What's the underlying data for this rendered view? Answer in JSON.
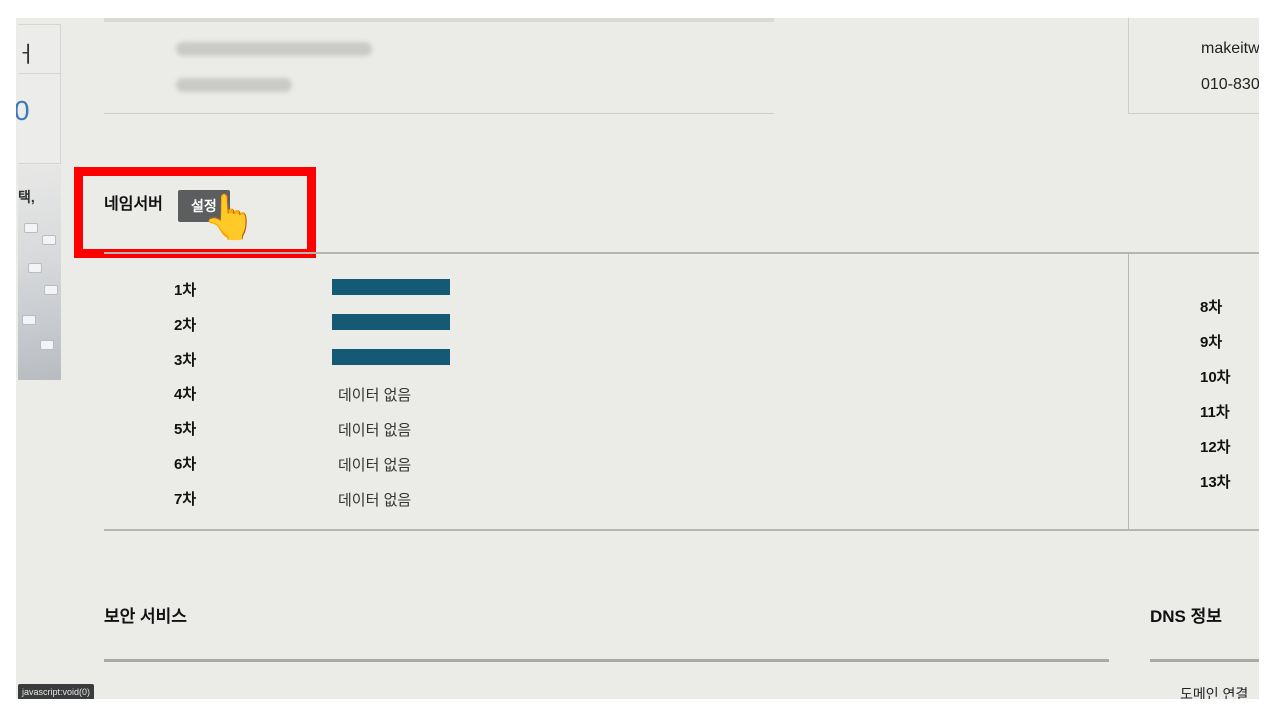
{
  "left_panel": {
    "card_char_top": "ㅓ",
    "card_char_bottom": "0",
    "banner_text": "택,"
  },
  "contact": {
    "right_email": "makeitw",
    "right_phone": "010-830"
  },
  "nameserver": {
    "title": "네임서버",
    "settings_button": "설정",
    "rows": [
      {
        "label": "1차",
        "value": ""
      },
      {
        "label": "2차",
        "value": ""
      },
      {
        "label": "3차",
        "value": ""
      },
      {
        "label": "4차",
        "value": "데이터 없음"
      },
      {
        "label": "5차",
        "value": "데이터 없음"
      },
      {
        "label": "6차",
        "value": "데이터 없음"
      },
      {
        "label": "7차",
        "value": "데이터 없음"
      }
    ],
    "right_labels": [
      "8차",
      "9차",
      "10차",
      "11차",
      "12차",
      "13차"
    ]
  },
  "security": {
    "title": "보안 서비스"
  },
  "dns": {
    "title": "DNS 정보",
    "domain_link": "도메인 연결"
  },
  "status_bar": {
    "link_preview": "javascript:void(0)"
  },
  "colors": {
    "highlight": "#ff0000",
    "button_bg": "#5b5d5f",
    "redaction": "#155a75",
    "background": "#ebebe8"
  },
  "icons": {
    "cursor": "pointing-hand-icon"
  }
}
